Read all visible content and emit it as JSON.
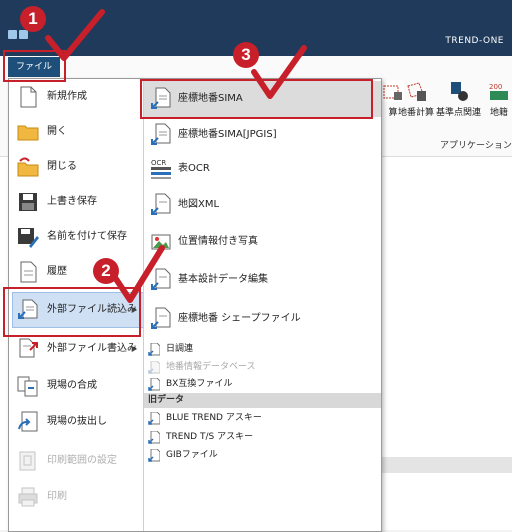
{
  "app": {
    "title": "TREND-ONE"
  },
  "ribbon": {
    "file_tab": "ファイル",
    "buttons": [
      "算",
      "地番計算",
      "基準点関連",
      "地籍"
    ],
    "group_label": "アプリケーション"
  },
  "file_menu": {
    "left_items": [
      {
        "label": "新規作成",
        "icon": "new-file-icon"
      },
      {
        "label": "開く",
        "icon": "folder-open-icon"
      },
      {
        "label": "閉じる",
        "icon": "folder-close-icon"
      },
      {
        "label": "上書き保存",
        "icon": "save-icon"
      },
      {
        "label": "名前を付けて保存",
        "icon": "save-as-icon"
      },
      {
        "label": "履歴",
        "icon": "history-icon"
      },
      {
        "label": "外部ファイル読込み",
        "icon": "import-file-icon",
        "arrow": "▶"
      },
      {
        "label": "外部ファイル書込み",
        "icon": "export-file-icon",
        "arrow": "▶"
      },
      {
        "label": "現場の合成",
        "icon": "merge-site-icon"
      },
      {
        "label": "現場の抜出し",
        "icon": "extract-site-icon"
      },
      {
        "label": "印刷範囲の設定",
        "icon": "print-range-icon"
      },
      {
        "label": "印刷",
        "icon": "print-icon"
      }
    ],
    "submenu_items": [
      {
        "label": "座標地番SIMA",
        "icon": "sima-import-icon"
      },
      {
        "label": "座標地番SIMA[JPGIS]",
        "icon": "sima-jpgis-icon"
      },
      {
        "label": "表OCR",
        "icon": "ocr-icon",
        "icon_text": "OCR"
      },
      {
        "label": "地図XML",
        "icon": "map-xml-icon"
      },
      {
        "label": "位置情報付き写真",
        "icon": "geo-photo-icon"
      },
      {
        "label": "基本設計データ編集",
        "icon": "design-data-icon"
      },
      {
        "label": "座標地番 シェープファイル",
        "icon": "shapefile-icon"
      }
    ],
    "small_items": [
      {
        "label": "日調連",
        "icon": "nicchoren-icon"
      },
      {
        "label": "地番情報データベース",
        "icon": "parcel-db-icon"
      },
      {
        "label": "BX互換ファイル",
        "icon": "bx-file-icon"
      }
    ],
    "legacy_header": "旧データ",
    "legacy_items": [
      {
        "label": "BLUE TREND アスキー",
        "icon": "blue-trend-icon"
      },
      {
        "label": "TREND T/S アスキー",
        "icon": "trend-ts-icon"
      },
      {
        "label": "GIBファイル",
        "icon": "gib-file-icon"
      }
    ]
  },
  "annotations": {
    "step1": "1",
    "step2": "2",
    "step3": "3"
  },
  "colors": {
    "highlight_red": "#c8202a",
    "title_bar": "#1f3a5a",
    "accent_blue": "#1e4f7a"
  }
}
